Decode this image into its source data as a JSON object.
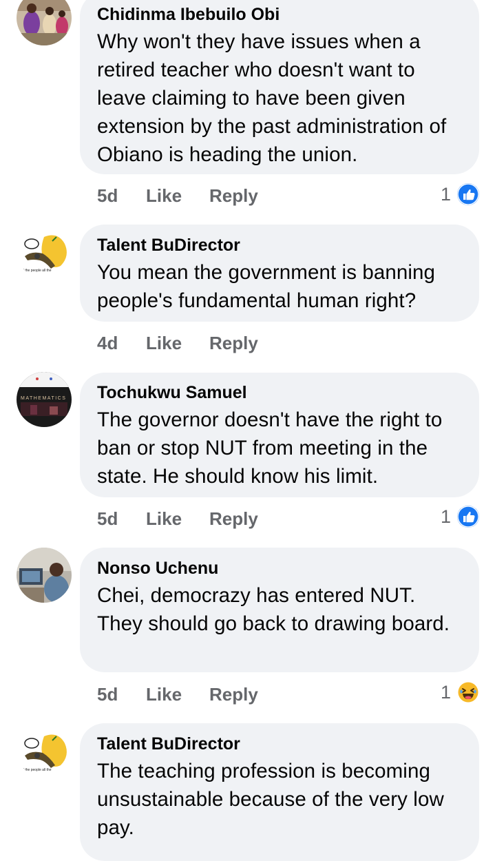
{
  "comments": [
    {
      "author": "Chidinma Ibebuilo Obi",
      "text": "Why won't they have issues when a retired teacher who doesn't want to leave claiming to have been given extension by the past administration of Obiano is heading the union.",
      "time": "5d",
      "like_label": "Like",
      "reply_label": "Reply",
      "reaction_count": "1",
      "reaction_icon": "thumbs-up-icon"
    },
    {
      "author": "Talent BuDirector",
      "text": "You mean the government is banning people's fundamental human right?",
      "time": "4d",
      "like_label": "Like",
      "reply_label": "Reply",
      "avatar_caption": "all the people all the"
    },
    {
      "author": "Tochukwu Samuel",
      "text": "The governor doesn't have the right to ban or stop NUT from meeting in the state. He should know his limit.",
      "time": "5d",
      "like_label": "Like",
      "reply_label": "Reply",
      "reaction_count": "1",
      "reaction_icon": "thumbs-up-icon",
      "avatar_caption": "MATHEMATICS"
    },
    {
      "author": "Nonso Uchenu",
      "text": "Chei, democrazy has entered NUT. They should go back to drawing board.",
      "time": "5d",
      "like_label": "Like",
      "reply_label": "Reply",
      "reaction_count": "1",
      "reaction_icon": "laughing-face-icon"
    },
    {
      "author": "Talent BuDirector",
      "text": "The teaching profession is becoming unsustainable because of the very low pay.",
      "avatar_caption": "all the people all the"
    }
  ],
  "colors": {
    "bubble": "#f0f2f5",
    "meta_text": "#65676b",
    "like_blue": "#1877f2",
    "haha_yellow": "#f7b928"
  }
}
